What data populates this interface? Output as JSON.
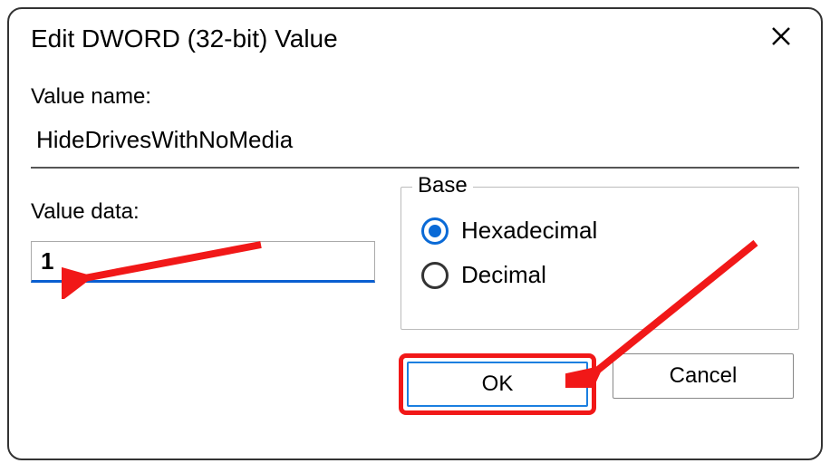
{
  "dialog": {
    "title": "Edit DWORD (32-bit) Value",
    "value_name_label": "Value name:",
    "value_name": "HideDrivesWithNoMedia",
    "value_data_label": "Value data:",
    "value_data": "1",
    "base": {
      "legend": "Base",
      "options": {
        "hex": "Hexadecimal",
        "dec": "Decimal"
      },
      "selected": "hex"
    },
    "buttons": {
      "ok": "OK",
      "cancel": "Cancel"
    }
  }
}
